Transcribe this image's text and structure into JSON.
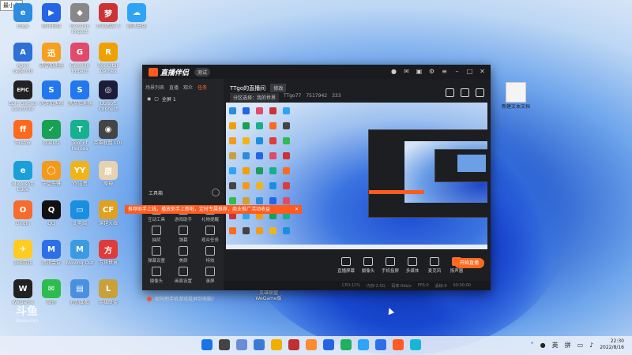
{
  "desktop": {
    "corner_tag": "最小化",
    "icons": [
      {
        "label": "Edge",
        "color": "#2b8ce0",
        "glyph": "e"
      },
      {
        "label": "腾讯视频",
        "color": "#2465e6",
        "glyph": "▶"
      },
      {
        "label": "Genshin Impact",
        "color": "#888",
        "glyph": "◆"
      },
      {
        "label": "梦幻西游 3",
        "color": "#c33",
        "glyph": "梦"
      },
      {
        "label": "腾讯云盘",
        "color": "#2da4f5",
        "glyph": "☁"
      },
      {
        "label": "Apex Legends",
        "color": "#2d70d6",
        "glyph": "A"
      },
      {
        "label": "迅雷加速器",
        "color": "#f5a020",
        "glyph": "迅"
      },
      {
        "label": "Genshin Impact",
        "color": "#e04b6a",
        "glyph": "G"
      },
      {
        "label": "Rockstar Games Launcher",
        "color": "#f0a000",
        "glyph": "R"
      },
      {
        "label": "Epic Games Launcher",
        "color": "#222",
        "glyph": "EPIC"
      },
      {
        "label": "迅游加速器",
        "color": "#2277ee",
        "glyph": "S"
      },
      {
        "label": "迅游加速器",
        "color": "#2277ee",
        "glyph": "S"
      },
      {
        "label": "Ubisoft Connect",
        "color": "#1d1d3a",
        "glyph": "◎"
      },
      {
        "label": "Firefox",
        "color": "#ff6a1a",
        "glyph": "ff"
      },
      {
        "label": "网易UU",
        "color": "#18a055",
        "glyph": "✓"
      },
      {
        "label": "Tool of Heroes",
        "color": "#15b08c",
        "glyph": "T"
      },
      {
        "label": "英雄联盟 LOL",
        "color": "#444",
        "glyph": "◉"
      },
      {
        "label": "Microsoft Edge",
        "color": "#1aa0d8",
        "glyph": "e"
      },
      {
        "label": "守望先锋",
        "color": "#f39a1a",
        "glyph": "◯"
      },
      {
        "label": "YY语音",
        "color": "#f0b41a",
        "glyph": "YY"
      },
      {
        "label": "原神",
        "color": "#e6d2b0",
        "glyph": "原"
      },
      {
        "label": "Origin",
        "color": "#f56c2d",
        "glyph": "O"
      },
      {
        "label": "QQ",
        "color": "#111",
        "glyph": "Q"
      },
      {
        "label": "此电脑",
        "color": "#1a8fe0",
        "glyph": "▭"
      },
      {
        "label": "穿越火线",
        "color": "#e0a020",
        "glyph": "CF"
      },
      {
        "label": "360游戏",
        "color": "#ffcc22",
        "glyph": "✈"
      },
      {
        "label": "腾讯会议",
        "color": "#2d6fe6",
        "glyph": "M"
      },
      {
        "label": "Moving Out",
        "color": "#3b9be0",
        "glyph": "M"
      },
      {
        "label": "方块世界",
        "color": "#e03a3a",
        "glyph": "方"
      },
      {
        "label": "WeGame",
        "color": "#222",
        "glyph": "W"
      },
      {
        "label": "微信",
        "color": "#2dbd4e",
        "glyph": "✉"
      },
      {
        "label": "控制面板",
        "color": "#4a90e0",
        "glyph": "▤"
      },
      {
        "label": "英雄联盟",
        "color": "#c8a13a",
        "glyph": "L"
      },
      {
        "label": "新建文本文档",
        "color": "#f4f4f4",
        "glyph": ""
      }
    ],
    "big_icon_label": "英雄联盟 WeGame版",
    "watermark_title": "斗鱼",
    "watermark_sub": "douyu.com"
  },
  "app": {
    "name": "直播伴侣",
    "version_badge": "测试",
    "left_tabs": [
      "场景列表",
      "直播",
      "观众",
      "任务"
    ],
    "left_tab_active": 3,
    "scene_label": "全屏 1",
    "tools_heading": "工具箱",
    "tools": [
      "互动工具",
      "游戏助手",
      "礼物提醒",
      "抽奖",
      "弹幕",
      "观众任务",
      "弹幕设置",
      "美颜",
      "特效",
      "摄像头",
      "画面设置",
      "录屏"
    ],
    "footer_text": "如何把手机游戏投屏到电脑?",
    "room_title": "TTgo的直播间",
    "edit_label": "修改",
    "room_meta": [
      "分区选择：我的世界",
      "TTgo77",
      "7517942",
      "333"
    ],
    "banner_text": "推荐助手上线，播放助手上新啦，定时专属推荐，商业推广活动收益",
    "bottom_tools": [
      "直播屏幕",
      "摄像头",
      "手机投屏",
      "多媒体",
      "麦克风",
      "扬声器"
    ],
    "start_label": "开始直播",
    "status": [
      "CPU:11%",
      "内存:2.5G",
      "码率:0kb/s",
      "FPS:0",
      "丢帧:0",
      "00:00:00"
    ]
  },
  "taskbar": {
    "tray": [
      "英",
      "拼"
    ],
    "time": "22:30",
    "date": "2022/8/16"
  },
  "colors": {
    "accent": "#ff6a1f",
    "window_bg": "#1d1e22"
  }
}
